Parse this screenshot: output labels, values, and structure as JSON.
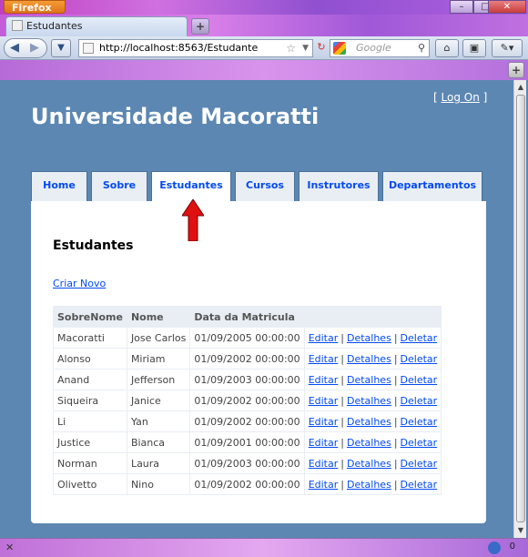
{
  "browser": {
    "menu_button": "Firefox",
    "tab_title": "Estudantes",
    "url": "http://localhost:8563/Estudante",
    "search_placeholder": "Google"
  },
  "page": {
    "login_prefix": "[ ",
    "login_link": "Log On",
    "login_suffix": " ]",
    "site_title": "Universidade Macoratti",
    "menu": [
      "Home",
      "Sobre",
      "Estudantes",
      "Cursos",
      "Instrutores",
      "Departamentos"
    ],
    "active_menu": "Estudantes",
    "heading": "Estudantes",
    "create_link": "Criar Novo",
    "table": {
      "headers": [
        "SobreNome",
        "Nome",
        "Data da Matricula",
        ""
      ],
      "rows": [
        [
          "Macoratti",
          "Jose Carlos",
          "01/09/2005 00:00:00"
        ],
        [
          "Alonso",
          "Miriam",
          "01/09/2002 00:00:00"
        ],
        [
          "Anand",
          "Jefferson",
          "01/09/2003 00:00:00"
        ],
        [
          "Siqueira",
          "Janice",
          "01/09/2002 00:00:00"
        ],
        [
          "Li",
          "Yan",
          "01/09/2002 00:00:00"
        ],
        [
          "Justice",
          "Bianca",
          "01/09/2001 00:00:00"
        ],
        [
          "Norman",
          "Laura",
          "01/09/2003 00:00:00"
        ],
        [
          "Olivetto",
          "Nino",
          "01/09/2002 00:00:00"
        ]
      ],
      "actions": [
        "Editar",
        "Detalhes",
        "Deletar"
      ],
      "action_separator": "|"
    }
  },
  "status": {
    "count": "0"
  },
  "colors": {
    "page_bg": "#5c87b2",
    "link": "#034af3",
    "arrow": "#e01010"
  }
}
